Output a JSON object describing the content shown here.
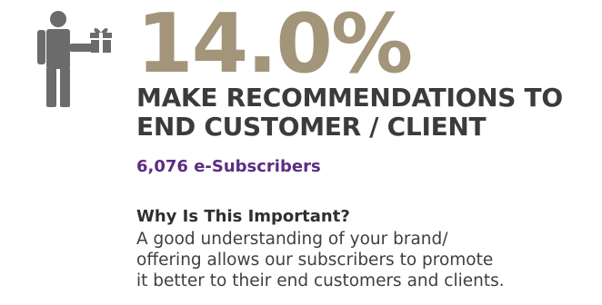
{
  "icon": "person-with-gift-icon",
  "colors": {
    "stat": "#a2957a",
    "headline": "#3b3b3b",
    "subscribers": "#5b2d82",
    "icon": "#6b6b6b"
  },
  "stat": {
    "value": "14.0%"
  },
  "headline": {
    "line1": "MAKE RECOMMENDATIONS TO",
    "line2": "END CUSTOMER / CLIENT"
  },
  "subscribers": {
    "text": "6,076 e-Subscribers"
  },
  "why": {
    "title": "Why Is This Important?",
    "lines": [
      "A good understanding of your brand/",
      "offering allows our subscribers to promote",
      "it better to their end customers and clients."
    ]
  }
}
